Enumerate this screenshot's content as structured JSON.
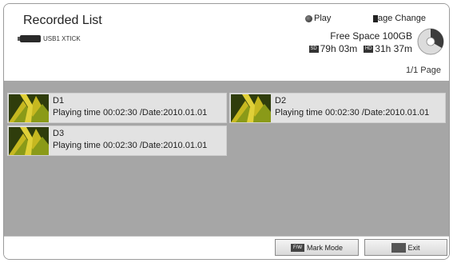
{
  "header": {
    "title": "Recorded List",
    "device": "USB1 XTICK",
    "hint_play": "Play",
    "hint_page": "age Change",
    "free_space": "Free Space 100GB",
    "sd_tag": "SD",
    "sd_time": "79h 03m",
    "hd_tag": "HD",
    "hd_time": "31h 37m",
    "page": "1/1 Page"
  },
  "items": [
    {
      "name": "D1",
      "info": "Playing time 00:02:30 /Date:2010.01.01"
    },
    {
      "name": "D2",
      "info": "Playing time 00:02:30 /Date:2010.01.01"
    },
    {
      "name": "D3",
      "info": "Playing time 00:02:30 /Date:2010.01.01"
    }
  ],
  "footer": {
    "mark_key": "F/W",
    "mark_label": "Mark Mode",
    "exit_label": "Exit"
  },
  "colors": {
    "list_background": "#a6a6a6",
    "item_background": "#e2e2e2"
  }
}
